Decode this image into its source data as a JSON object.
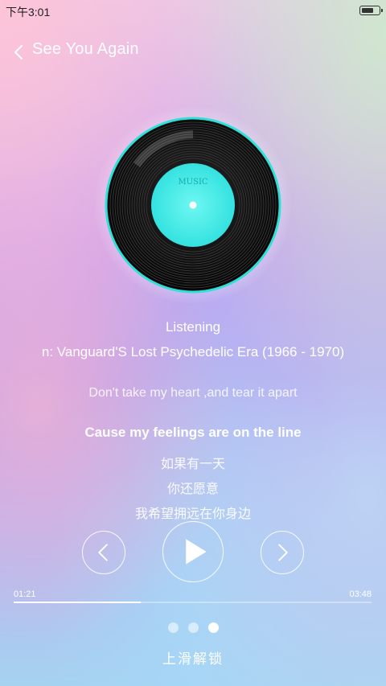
{
  "status_bar": {
    "time": "下午3:01",
    "battery_level": 0.75
  },
  "header": {
    "title": "See You Again",
    "back_icon": "chevron-left-icon"
  },
  "record": {
    "label": "MUSIC",
    "label_color": "#3fe8e6",
    "rim_color": "#2de0d8"
  },
  "track": {
    "status": "Listening",
    "album": "n: Vanguard'S Lost Psychedelic Era (1966 - 1970)"
  },
  "lyrics": [
    "Don't take my heart ,and tear it apart",
    "Cause my feelings are on the line",
    "如果有一天",
    "你还愿意",
    "我希望拥远在你身边"
  ],
  "controls": {
    "prev_icon": "chevron-left-icon",
    "play_icon": "play-icon",
    "next_icon": "chevron-right-icon"
  },
  "progress": {
    "current": "01:21",
    "total": "03:48",
    "fraction": 0.355
  },
  "pager": {
    "count": 3,
    "active_index": 2
  },
  "unlock_text": "上滑解锁"
}
